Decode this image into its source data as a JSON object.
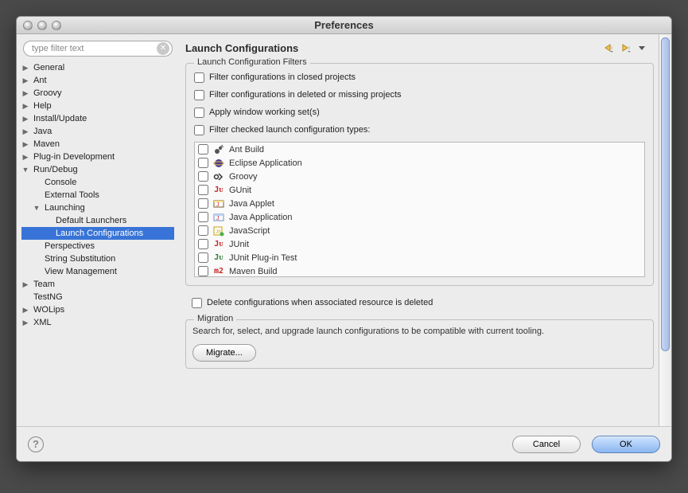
{
  "window": {
    "title": "Preferences"
  },
  "sidebar": {
    "filter_placeholder": "type filter text",
    "items": [
      {
        "label": "General",
        "depth": 0,
        "arrow": "collapsed"
      },
      {
        "label": "Ant",
        "depth": 0,
        "arrow": "collapsed"
      },
      {
        "label": "Groovy",
        "depth": 0,
        "arrow": "collapsed"
      },
      {
        "label": "Help",
        "depth": 0,
        "arrow": "collapsed"
      },
      {
        "label": "Install/Update",
        "depth": 0,
        "arrow": "collapsed"
      },
      {
        "label": "Java",
        "depth": 0,
        "arrow": "collapsed"
      },
      {
        "label": "Maven",
        "depth": 0,
        "arrow": "collapsed"
      },
      {
        "label": "Plug-in Development",
        "depth": 0,
        "arrow": "collapsed"
      },
      {
        "label": "Run/Debug",
        "depth": 0,
        "arrow": "expanded"
      },
      {
        "label": "Console",
        "depth": 1,
        "arrow": "none"
      },
      {
        "label": "External Tools",
        "depth": 1,
        "arrow": "none"
      },
      {
        "label": "Launching",
        "depth": 1,
        "arrow": "expanded"
      },
      {
        "label": "Default Launchers",
        "depth": 2,
        "arrow": "none"
      },
      {
        "label": "Launch Configurations",
        "depth": 2,
        "arrow": "none",
        "selected": true
      },
      {
        "label": "Perspectives",
        "depth": 1,
        "arrow": "none"
      },
      {
        "label": "String Substitution",
        "depth": 1,
        "arrow": "none"
      },
      {
        "label": "View Management",
        "depth": 1,
        "arrow": "none"
      },
      {
        "label": "Team",
        "depth": 0,
        "arrow": "collapsed"
      },
      {
        "label": "TestNG",
        "depth": 0,
        "arrow": "none"
      },
      {
        "label": "WOLips",
        "depth": 0,
        "arrow": "collapsed"
      },
      {
        "label": "XML",
        "depth": 0,
        "arrow": "collapsed"
      }
    ]
  },
  "main": {
    "title": "Launch Configurations",
    "filters_group_label": "Launch Configuration Filters",
    "filter_closed": "Filter configurations in closed projects",
    "filter_deleted": "Filter configurations in deleted or missing projects",
    "apply_working_set": "Apply window working set(s)",
    "filter_types": "Filter checked launch configuration types:",
    "types": [
      {
        "label": "Ant Build",
        "icon": "ant"
      },
      {
        "label": "Eclipse Application",
        "icon": "eclipse"
      },
      {
        "label": "Groovy",
        "icon": "groovy"
      },
      {
        "label": "GUnit",
        "icon": "junit"
      },
      {
        "label": "Java Applet",
        "icon": "applet"
      },
      {
        "label": "Java Application",
        "icon": "java"
      },
      {
        "label": "JavaScript",
        "icon": "js"
      },
      {
        "label": "JUnit",
        "icon": "junit"
      },
      {
        "label": "JUnit Plug-in Test",
        "icon": "junit-plugin"
      },
      {
        "label": "Maven Build",
        "icon": "maven"
      }
    ],
    "delete_when_resource_deleted": "Delete configurations when associated resource is deleted",
    "migration_label": "Migration",
    "migration_desc": "Search for, select, and upgrade launch configurations to be compatible with current tooling.",
    "migrate_btn": "Migrate..."
  },
  "footer": {
    "cancel": "Cancel",
    "ok": "OK"
  }
}
